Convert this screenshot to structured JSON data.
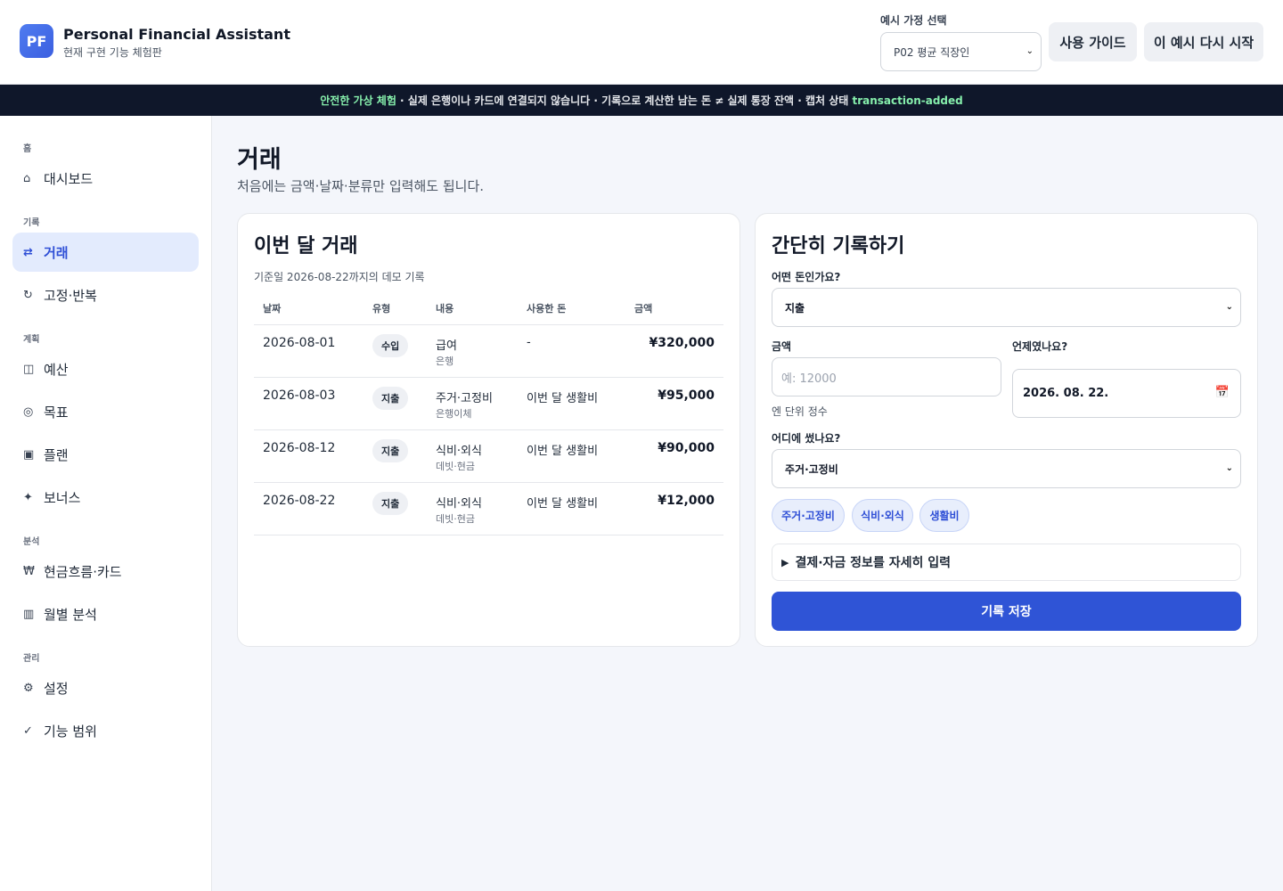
{
  "app": {
    "logo_text": "PF",
    "title": "Personal Financial Assistant",
    "subtitle": "현재 구현 기능 체험판"
  },
  "header": {
    "household_label": "예시 가정 선택",
    "household_selected": "P02 평균 직장인",
    "guide_button": "사용 가이드",
    "restart_button": "이 예시 다시 시작"
  },
  "banner": {
    "highlight": "안전한 가상 체험",
    "text": " · 실제 은행이나 카드에 연결되지 않습니다 · 기록으로 계산한 남는 돈 ≠ 실제 통장 잔액 · 캡처 상태 ",
    "state": "transaction-added"
  },
  "sidebar": {
    "sections": [
      {
        "label": "홈"
      },
      {
        "label": "기록"
      },
      {
        "label": "계획"
      },
      {
        "label": "분석"
      },
      {
        "label": "관리"
      }
    ],
    "items": [
      {
        "icon": "⌂",
        "label": "대시보드"
      },
      {
        "icon": "⇄",
        "label": "거래"
      },
      {
        "icon": "↻",
        "label": "고정·반복"
      },
      {
        "icon": "◫",
        "label": "예산"
      },
      {
        "icon": "◎",
        "label": "목표"
      },
      {
        "icon": "▣",
        "label": "플랜"
      },
      {
        "icon": "✦",
        "label": "보너스"
      },
      {
        "icon": "₩",
        "label": "현금흐름·카드"
      },
      {
        "icon": "▥",
        "label": "월별 분석"
      },
      {
        "icon": "⚙",
        "label": "설정"
      },
      {
        "icon": "✓",
        "label": "기능 범위"
      }
    ]
  },
  "main": {
    "title": "거래",
    "subtitle": "처음에는 금액·날짜·분류만 입력해도 됩니다."
  },
  "transactions": {
    "title": "이번 달 거래",
    "as_of": "기준일 2026-08-22까지의 데모 기록",
    "columns": [
      "날짜",
      "유형",
      "내용",
      "사용한 돈",
      "금액"
    ],
    "rows": [
      {
        "date": "2026-08-01",
        "type": "수입",
        "desc": "급여",
        "desc_sub": "은행",
        "spent": "-",
        "amount": "¥320,000"
      },
      {
        "date": "2026-08-03",
        "type": "지출",
        "desc": "주거·고정비",
        "desc_sub": "은행이체",
        "spent": "이번 달 생활비",
        "amount": "¥95,000"
      },
      {
        "date": "2026-08-12",
        "type": "지출",
        "desc": "식비·외식",
        "desc_sub": "데빗·현금",
        "spent": "이번 달 생활비",
        "amount": "¥90,000"
      },
      {
        "date": "2026-08-22",
        "type": "지출",
        "desc": "식비·외식",
        "desc_sub": "데빗·현금",
        "spent": "이번 달 생활비",
        "amount": "¥12,000"
      }
    ]
  },
  "form": {
    "title": "간단히 기록하기",
    "kind_label": "어떤 돈인가요?",
    "kind_value": "지출",
    "amount_label": "금액",
    "amount_placeholder": "예: 12000",
    "amount_hint": "엔 단위 정수",
    "date_label": "언제였나요?",
    "date_value": "2026. 08. 22.",
    "category_label": "어디에 썼나요?",
    "category_value": "주거·고정비",
    "chips": [
      "주거·고정비",
      "식비·외식",
      "생활비"
    ],
    "details_label": "결제·자금 정보를 자세히 입력",
    "save_button": "기록 저장"
  }
}
